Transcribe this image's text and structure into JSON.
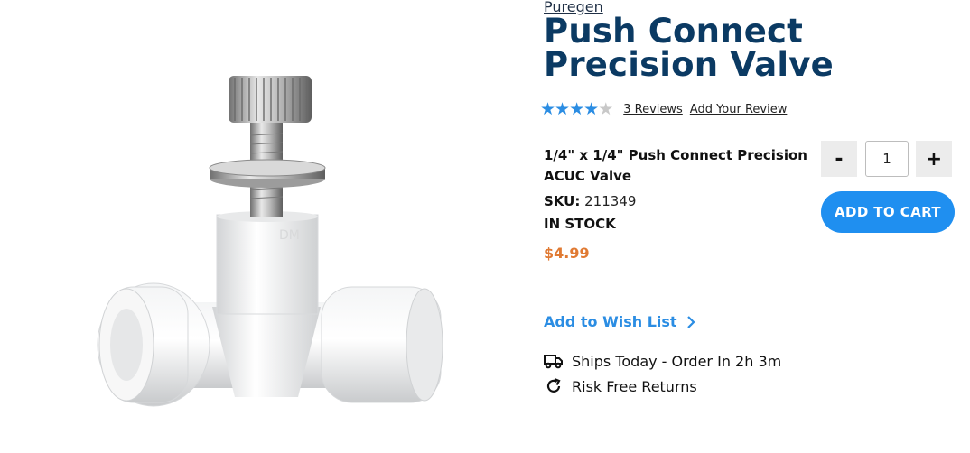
{
  "product": {
    "brand": "Puregen",
    "title": "Push Connect Precision Valve",
    "rating": 4,
    "rating_max": 5,
    "reviews_link": "3  Reviews",
    "add_review": "Add Your Review",
    "variant_name": "1/4\" x 1/4\" Push Connect Precision ACUC Valve",
    "sku_label": "SKU:",
    "sku_value": "211349",
    "stock_status": "IN STOCK",
    "price": "$4.99",
    "image_alt_text": "DM"
  },
  "purchase": {
    "qty_minus": "-",
    "qty_value": "1",
    "qty_plus": "+",
    "add_to_cart": "ADD TO CART"
  },
  "actions": {
    "wishlist": "Add to Wish List",
    "wishlist_icon": "chevron-right-icon"
  },
  "shipping": {
    "ships_text": "Ships Today - Order In 2h 3m",
    "ships_icon": "truck-icon",
    "returns_text": "Risk Free Returns",
    "returns_icon": "refresh-icon"
  },
  "colors": {
    "title": "#0b3a63",
    "accent": "#1f8ff0",
    "link": "#2b8de3",
    "price": "#e07a33"
  }
}
